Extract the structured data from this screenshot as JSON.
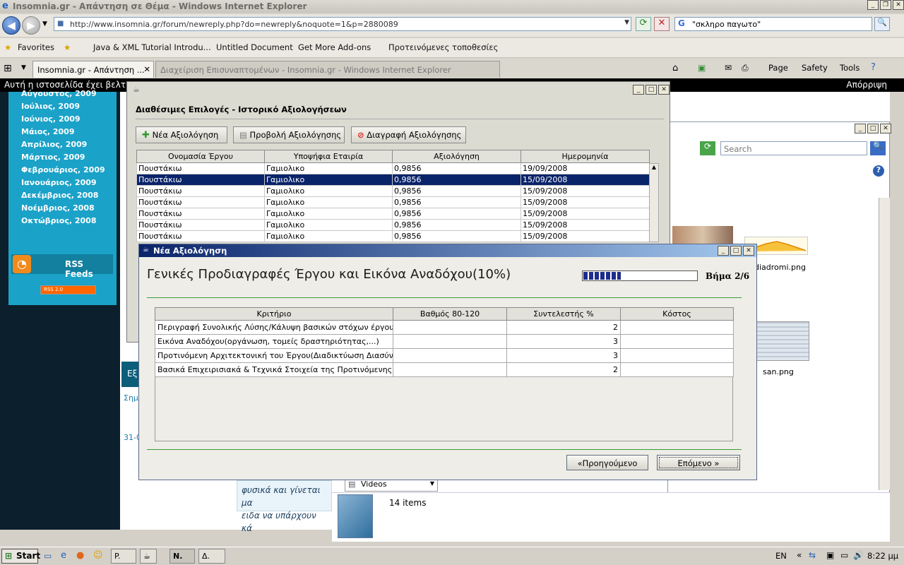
{
  "browser": {
    "window_title": "Insomnia.gr - Απάντηση σε Θέμα - Windows Internet Explorer",
    "address_url": "http://www.insomnia.gr/forum/newreply.php?do=newreply&noquote=1&p=2880089",
    "search_value": "\"σκληρο παγωτο\"",
    "favorites_label": "Favorites",
    "favorites": [
      "Java & XML Tutorial Introdu...",
      "Untitled Document",
      "Get More Add-ons",
      "Προτεινόμενες τοποθεσίες"
    ],
    "tabs": [
      "Insomnia.gr - Απάντηση ...",
      "Διαχείριση Επισυναπτομένων - Insomnia.gr - Windows Internet Explorer"
    ],
    "commands": [
      "Page",
      "Safety",
      "Tools"
    ],
    "infobar_text": "Αυτή η ιστοσελίδα έχει βελτιστ",
    "infobar_close": "Απόρριψη"
  },
  "webpage": {
    "archive_months": [
      "Αύγουστος, 2009",
      "Ιούλιος, 2009",
      "Ιούνιος, 2009",
      "Μάιος, 2009",
      "Απρίλιος, 2009",
      "Μάρτιος, 2009",
      "Φεβρουάριος, 2009",
      "Ιανουάριος, 2009",
      "Δεκέμβριος, 2008",
      "Νοέμβριος, 2008",
      "Οκτώβριος, 2008"
    ],
    "rss_label": "RSS Feeds",
    "rss_badge": "RSS 2.0",
    "side_fragments": [
      "Εξ",
      "Σημ",
      "31-0"
    ],
    "post_text_1": "φυσικά και γίνεται μα",
    "post_text_2": "ειδα να υπάρχουν κά"
  },
  "explorer": {
    "search_placeholder": "Search",
    "thumbnails": [
      "diadromi.png",
      "san.png"
    ],
    "folder_item": "Videos",
    "item_count": "14 items"
  },
  "java_window": {
    "section_title": "Διαθέσιμες Επιλογές - Ιστορικό Αξιολογήσεων",
    "buttons": {
      "new": "Νέα Αξιολόγηση",
      "view": "Προβολή Αξιολόγησης",
      "delete": "Διαγραφή Αξιολόγησης"
    },
    "columns": [
      "Ονομασία Έργου",
      "Υποψήφια Εταιρία",
      "Αξιολόγηση",
      "Ημερομηνία"
    ],
    "rows": [
      [
        "Πουστάκιω",
        "Γαμιολικο",
        "0,9856",
        "19/09/2008"
      ],
      [
        "Πουστάκιω",
        "Γαμιολικο",
        "0,9856",
        "15/09/2008"
      ],
      [
        "Πουστάκιω",
        "Γαμιολικο",
        "0,9856",
        "15/09/2008"
      ],
      [
        "Πουστάκιω",
        "Γαμιολικο",
        "0,9856",
        "15/09/2008"
      ],
      [
        "Πουστάκιω",
        "Γαμιολικο",
        "0,9856",
        "15/09/2008"
      ],
      [
        "Πουστάκιω",
        "Γαμιολικο",
        "0,9856",
        "15/09/2008"
      ],
      [
        "Πουστάκιω",
        "Γαμιολικο",
        "0,9856",
        "15/09/2008"
      ]
    ],
    "selected_row": 1
  },
  "dialog": {
    "title": "Νέα Αξιολόγηση",
    "heading": "Γενικές Προδιαγραφές Έργου και Εικόνα Αναδόχου(10%)",
    "progress": 0.33,
    "step": "Βήμα 2/6",
    "columns": [
      "Κριτήριο",
      "Βαθμός 80-120",
      "Συντελεστής %",
      "Κόστος"
    ],
    "rows": [
      [
        "Περιγραφή Συνολικής Λύσης/Κάλυψη βασικών στόχων έργου",
        "",
        "2",
        ""
      ],
      [
        "Εικόνα Αναδόχου(οργάνωση, τομείς δραστηριότητας,...)",
        "",
        "3",
        ""
      ],
      [
        "Προτινόμενη Αρχιτεκτονική του Έργου(Διαδικτύωση Διασύνδεση)",
        "",
        "3",
        ""
      ],
      [
        "Βασικά Επιχειρισιακά & Τεχνικά Στοιχεία της Προτινόμενης Λύσης",
        "",
        "2",
        ""
      ]
    ],
    "prev_label": "«Προηγούμενο",
    "next_label": "Επόμενο »"
  },
  "taskbar": {
    "start": "Start",
    "items": [
      "P.",
      "N.",
      "Δ."
    ],
    "lang": "EN",
    "clock": "8:22 μμ"
  }
}
